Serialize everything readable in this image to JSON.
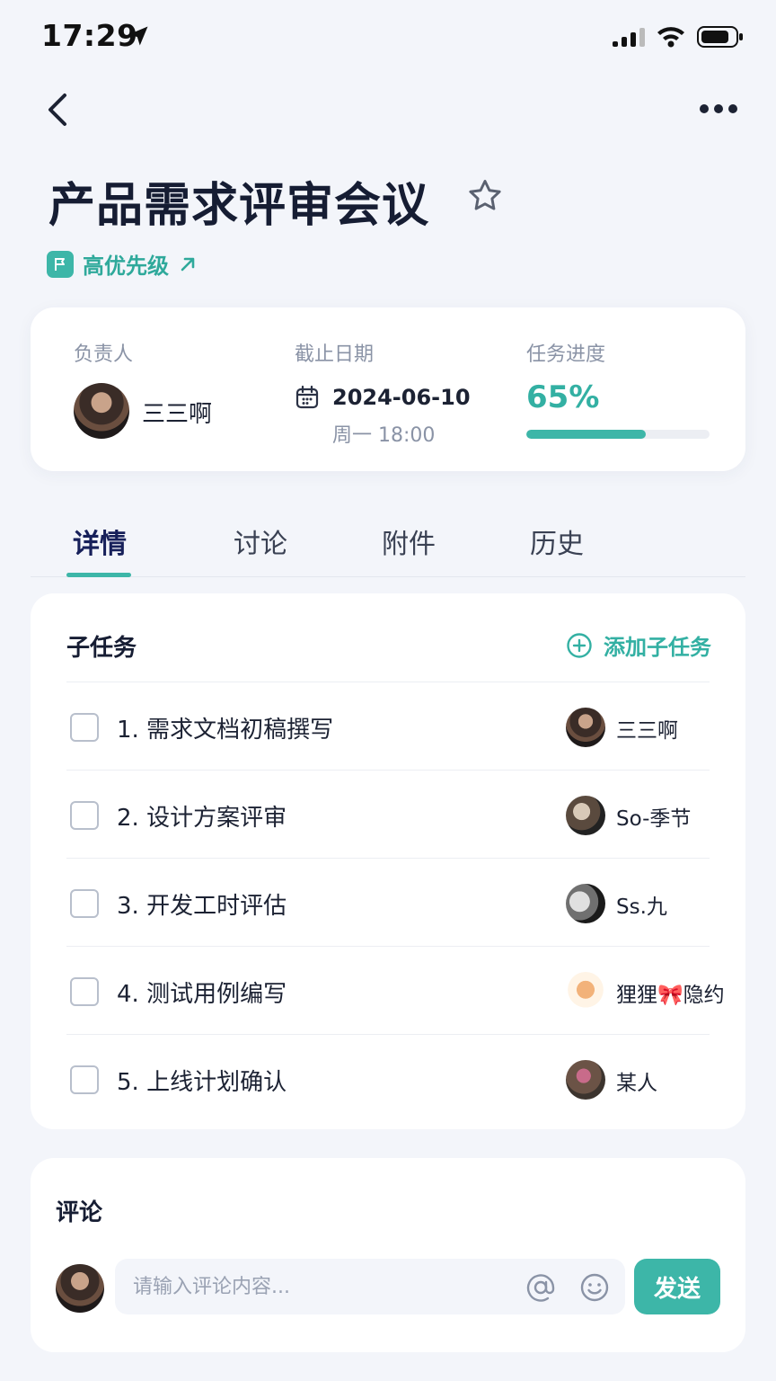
{
  "status_bar": {
    "time": "17:29"
  },
  "header": {
    "title": "产品需求评审会议",
    "priority": "高优先级"
  },
  "info": {
    "owner_label": "负责人",
    "owner_name": "三三啊",
    "due_label": "截止日期",
    "due_date": "2024-06-10",
    "due_time": "周一 18:00",
    "progress_label": "任务进度",
    "progress_text": "65%",
    "progress_value": 0.65
  },
  "tabs": [
    "详情",
    "讨论",
    "附件",
    "历史"
  ],
  "subtasks": {
    "title": "子任务",
    "add_label": "添加子任务",
    "items": [
      {
        "title": "1.  需求文档初稿撰写",
        "assignee": "三三啊"
      },
      {
        "title": "2.  设计方案评审",
        "assignee": "So-季节"
      },
      {
        "title": "3.  开发工时评估",
        "assignee": "Ss.九"
      },
      {
        "title": "4.  测试用例编写",
        "assignee": "狸狸🎀隐约"
      },
      {
        "title": "5.  上线计划确认",
        "assignee": "某人"
      }
    ]
  },
  "comments": {
    "title": "评论",
    "placeholder": "请输入评论内容...",
    "send_label": "发送"
  },
  "colors": {
    "accent": "#3db6a8",
    "title": "#161d33",
    "background": "#f3f5fa"
  }
}
